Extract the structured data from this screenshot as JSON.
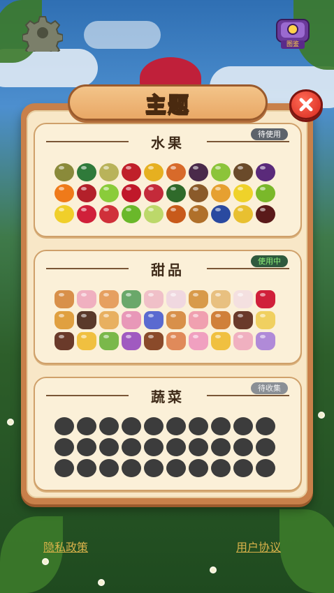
{
  "title": "主题",
  "sections": [
    {
      "name": "水果",
      "status": "待使用",
      "items": [
        "#8a8a3a",
        "#2f7a3a",
        "#b9b35a",
        "#c0202a",
        "#e6b020",
        "#d86a2a",
        "#4a2a4a",
        "#8cc43a",
        "#6a4a2a",
        "#5a2a7a",
        "#ef7a1a",
        "#b3202a",
        "#8acc3a",
        "#c0182a",
        "#c42a3a",
        "#2f6a2a",
        "#8a5a2a",
        "#e6a030",
        "#efd22a",
        "#7ab82a",
        "#f0cf2a",
        "#d0203a",
        "#d0303a",
        "#6ab82a",
        "#bcd86a",
        "#c85a1a",
        "#b0702a",
        "#2a4aa0",
        "#e8c030",
        "#5a1a1a"
      ]
    },
    {
      "name": "甜品",
      "status": "使用中",
      "items": [
        "#d8904a",
        "#f0b0c0",
        "#e6a060",
        "#6aa86a",
        "#f0c0c8",
        "#f0d8e0",
        "#d89a4a",
        "#e8c080",
        "#f4e0e0",
        "#d0203a",
        "#e0a040",
        "#5a3a2a",
        "#e8b060",
        "#e898b8",
        "#5a6ad0",
        "#d8904a",
        "#f0a0b0",
        "#d0803a",
        "#6a3a2a",
        "#f0d060",
        "#6a3a2a",
        "#f0c040",
        "#7ab84a",
        "#a05ac0",
        "#8a4a2a",
        "#e08a5a",
        "#f0a0c0",
        "#f0c040",
        "#f0b0c0",
        "#b08ad8"
      ]
    },
    {
      "name": "蔬菜",
      "status": "待收集",
      "items": [
        "#3c3c3c",
        "#3c3c3c",
        "#3c3c3c",
        "#3c3c3c",
        "#3c3c3c",
        "#3c3c3c",
        "#3c3c3c",
        "#3c3c3c",
        "#3c3c3c",
        "#3c3c3c",
        "#3c3c3c",
        "#3c3c3c",
        "#3c3c3c",
        "#3c3c3c",
        "#3c3c3c",
        "#3c3c3c",
        "#3c3c3c",
        "#3c3c3c",
        "#3c3c3c",
        "#3c3c3c",
        "#3c3c3c",
        "#3c3c3c",
        "#3c3c3c",
        "#3c3c3c",
        "#3c3c3c",
        "#3c3c3c",
        "#3c3c3c",
        "#3c3c3c",
        "#3c3c3c",
        "#3c3c3c"
      ]
    }
  ],
  "gallery_label": "图鉴",
  "footer": {
    "privacy": "隐私政策",
    "agreement": "用户协议"
  },
  "icons": {
    "settings": "gear-icon",
    "gallery": "gallery-icon",
    "close": "close-icon"
  }
}
